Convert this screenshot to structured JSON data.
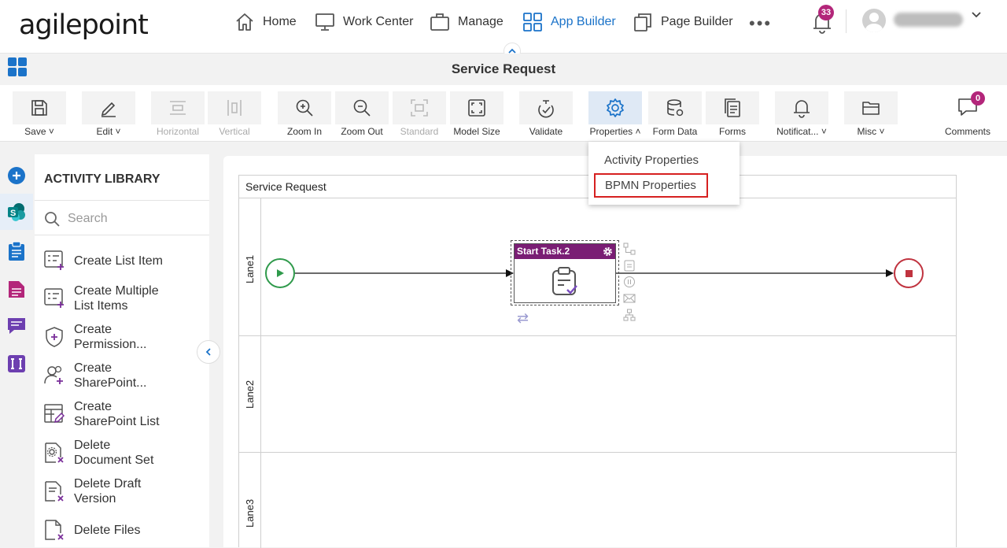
{
  "brand": {
    "logo_text": "agilepoint",
    "accent": "#1b73c9",
    "badge_color": "#b3267a"
  },
  "topnav": {
    "items": [
      {
        "label": "Home",
        "icon": "home-icon"
      },
      {
        "label": "Work Center",
        "icon": "monitor-icon"
      },
      {
        "label": "Manage",
        "icon": "briefcase-icon"
      },
      {
        "label": "App Builder",
        "icon": "grid-icon",
        "active": true
      },
      {
        "label": "Page Builder",
        "icon": "pages-icon"
      }
    ],
    "more_label": "•••",
    "notification_count": "33"
  },
  "page": {
    "title": "Service Request"
  },
  "toolbar": {
    "tools": [
      {
        "label": "Save",
        "dropdown": "˅",
        "icon": "save-icon",
        "enabled": true
      },
      {
        "label": "Edit",
        "dropdown": "˅",
        "icon": "pencil-icon",
        "enabled": true
      },
      {
        "label": "Horizontal",
        "icon": "horizontal-icon",
        "enabled": false
      },
      {
        "label": "Vertical",
        "icon": "vertical-icon",
        "enabled": false
      },
      {
        "label": "Zoom In",
        "icon": "zoom-in-icon",
        "enabled": true
      },
      {
        "label": "Zoom Out",
        "icon": "zoom-out-icon",
        "enabled": true
      },
      {
        "label": "Standard",
        "icon": "standard-icon",
        "enabled": false
      },
      {
        "label": "Model Size",
        "icon": "model-size-icon",
        "enabled": true
      },
      {
        "label": "Validate",
        "icon": "validate-icon",
        "enabled": true
      },
      {
        "label": "Properties",
        "dropdown": "˄",
        "icon": "gear-icon",
        "enabled": true,
        "open": true
      },
      {
        "label": "Form Data",
        "icon": "database-icon",
        "enabled": true
      },
      {
        "label": "Forms",
        "icon": "forms-icon",
        "enabled": true
      },
      {
        "label": "Notificat...",
        "dropdown": "˅",
        "icon": "bell-icon",
        "enabled": true
      },
      {
        "label": "Misc",
        "dropdown": "˅",
        "icon": "folder-icon",
        "enabled": true
      }
    ],
    "comments": {
      "label": "Comments",
      "count": "0"
    }
  },
  "properties_menu": {
    "items": [
      {
        "label": "Activity Properties"
      },
      {
        "label": "BPMN Properties",
        "highlighted": true
      }
    ]
  },
  "library": {
    "title": "ACTIVITY LIBRARY",
    "search_placeholder": "Search",
    "items": [
      {
        "label": "Create List Item",
        "icon": "list-add-icon"
      },
      {
        "label": "Create Multiple List Items",
        "icon": "list-add-icon"
      },
      {
        "label": "Create Permission...",
        "icon": "shield-add-icon"
      },
      {
        "label": "Create SharePoint...",
        "icon": "users-add-icon"
      },
      {
        "label": "Create SharePoint List",
        "icon": "table-edit-icon"
      },
      {
        "label": "Delete Document Set",
        "icon": "doc-gear-delete-icon"
      },
      {
        "label": "Delete Draft Version",
        "icon": "doc-delete-icon"
      },
      {
        "label": "Delete Files",
        "icon": "file-delete-icon"
      }
    ]
  },
  "diagram": {
    "pool_title": "Service Request",
    "lanes": [
      "Lane1",
      "Lane2",
      "Lane3"
    ],
    "task": {
      "title": "Start Task.2",
      "header_color": "#7a1e74"
    },
    "start_color": "#2f9a4b",
    "end_color": "#c0333f"
  }
}
